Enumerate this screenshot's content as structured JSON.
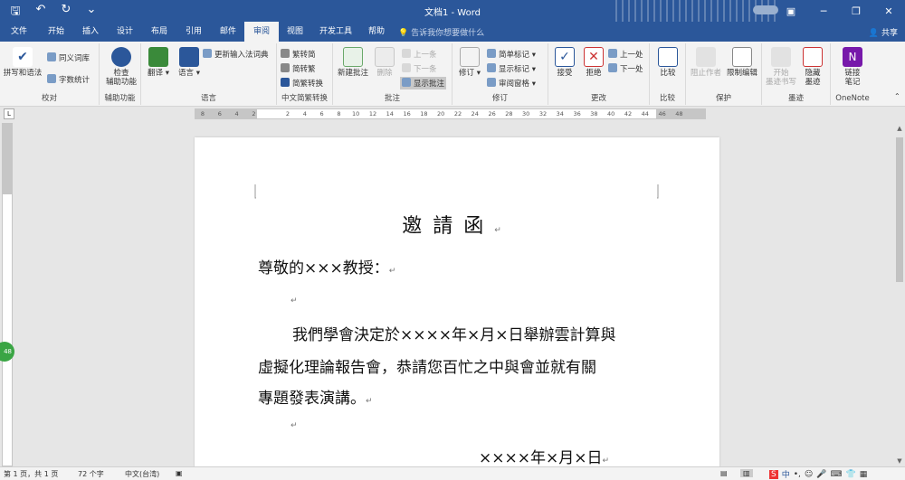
{
  "title_bar": {
    "document_title": "文档1 - Word",
    "qat": [
      "save-icon",
      "undo-icon",
      "redo-icon",
      "customize-icon"
    ],
    "controls": [
      "ribbon-options-icon",
      "minimize-icon",
      "restore-icon",
      "close-icon"
    ]
  },
  "tabs": [
    "文件",
    "开始",
    "插入",
    "设计",
    "布局",
    "引用",
    "邮件",
    "审阅",
    "视图",
    "开发工具",
    "帮助"
  ],
  "active_tab": "审阅",
  "tell_me": "告诉我你想要做什么",
  "share": "共享",
  "ribbon": {
    "proofing": {
      "label": "校对",
      "spelling": "拼写和语法",
      "thesaurus": "同义词库",
      "word_count": "字数统计"
    },
    "accessibility": {
      "label": "辅助功能",
      "check": "检查\n辅助功能"
    },
    "language": {
      "label": "语言",
      "translate": "翻译",
      "language": "语言",
      "ime": "更新输入法词典"
    },
    "chinese_conversion": {
      "label": "中文简繁转换",
      "to_simplified": "繁转简",
      "to_traditional": "简转繁",
      "convert": "简繁转换"
    },
    "comments": {
      "label": "批注",
      "new": "新建批注",
      "delete": "删除",
      "prev": "上一条",
      "next": "下一条",
      "show": "显示批注"
    },
    "tracking": {
      "label": "修订",
      "track": "修订",
      "markup": "简单标记",
      "show_markup": "显示标记",
      "pane": "审阅窗格"
    },
    "changes": {
      "label": "更改",
      "accept": "接受",
      "reject": "拒绝",
      "previous": "上一处",
      "next": "下一处"
    },
    "compare": {
      "label": "比较",
      "compare": "比较"
    },
    "protect": {
      "label": "保护",
      "block": "阻止作者",
      "restrict": "限制编辑"
    },
    "ink": {
      "label": "墨迹",
      "start": "开始\n墨迹书写",
      "hide": "隐藏\n墨迹"
    },
    "onenote": {
      "label": "OneNote",
      "linked": "链接\n笔记"
    }
  },
  "ruler": [
    "8",
    "6",
    "4",
    "2",
    "",
    "2",
    "4",
    "6",
    "8",
    "10",
    "12",
    "14",
    "16",
    "18",
    "20",
    "22",
    "24",
    "26",
    "28",
    "30",
    "32",
    "34",
    "36",
    "38",
    "40",
    "42",
    "44",
    "46",
    "48"
  ],
  "document": {
    "title": "邀請函",
    "salutation": "尊敬的×××教授：",
    "body_line1": "我們學會決定於××××年×月×日舉辦雲計算與",
    "body_line2": "虛擬化理論報告會，恭請您百忙之中與會並就有關",
    "body_line3": "專題發表演講。",
    "date": "××××年×月×日",
    "para_mark": "↵"
  },
  "status_bar": {
    "page": "第 1 页，共 1 页",
    "words": "72 个字",
    "language": "中文(台湾)"
  },
  "badge": "48",
  "colors": {
    "accent": "#2b579a",
    "ribbon_bg": "#f3f3f3"
  }
}
